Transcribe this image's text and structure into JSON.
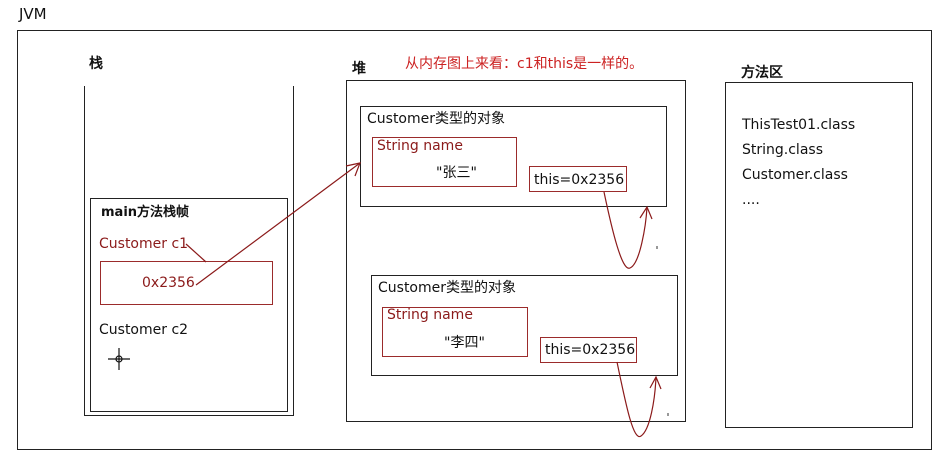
{
  "jvm_label": "JVM",
  "stack": {
    "title": "栈",
    "frame_title": "main方法栈帧",
    "var_c1": "Customer c1",
    "c1_value": "0x2356",
    "var_c2": "Customer c2"
  },
  "heap": {
    "title": "堆",
    "note": "从内存图上来看：c1和this是一样的。",
    "obj1": {
      "title": "Customer类型的对象",
      "field_label": "String name",
      "field_value": "\"张三\"",
      "this_label": "this=0x2356"
    },
    "obj2": {
      "title": "Customer类型的对象",
      "field_label": "String name",
      "field_value": "\"李四\"",
      "this_label": "this=0x2356"
    }
  },
  "method_area": {
    "title": "方法区",
    "items": [
      "ThisTest01.class",
      "String.class",
      "Customer.class",
      "...."
    ]
  },
  "colors": {
    "annotation_red": "#8b1a1a",
    "border": "#222222"
  }
}
